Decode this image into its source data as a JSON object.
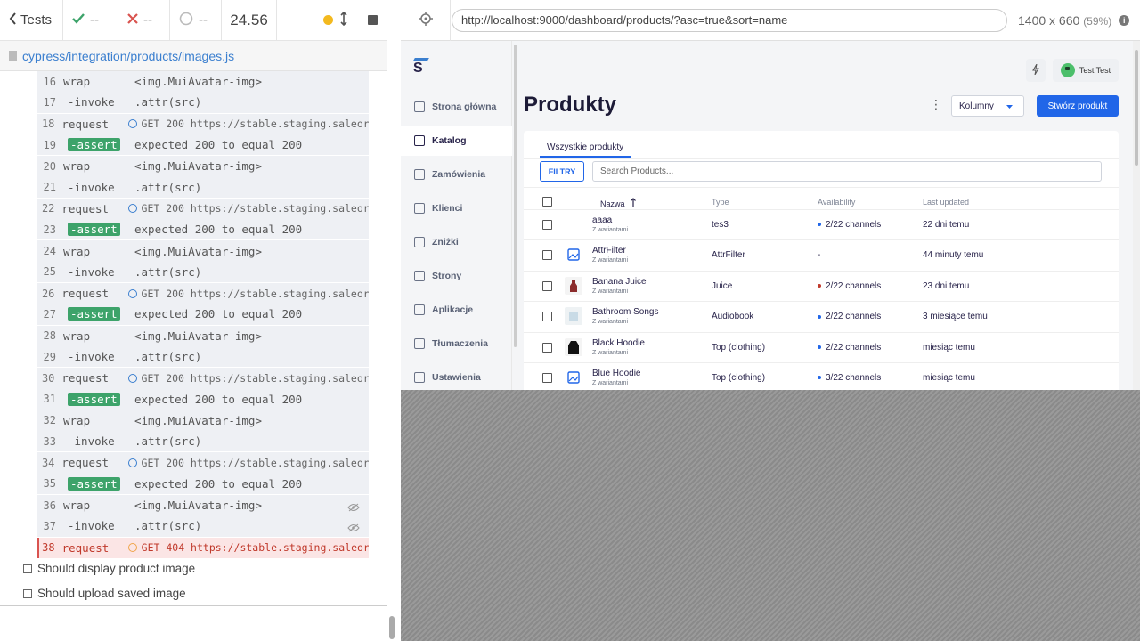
{
  "header": {
    "tests_label": "Tests",
    "passed": "--",
    "failed": "--",
    "pending": "--",
    "duration": "24.56"
  },
  "spec": {
    "path": "cypress/integration/products/images.js"
  },
  "commands": [
    {
      "num": "16",
      "name": "wrap",
      "msg": "<img.MuiAvatar-img>",
      "type": "plain"
    },
    {
      "num": "17",
      "name": "-invoke",
      "msg": ".attr(src)",
      "type": "child"
    },
    {
      "num": "18",
      "name": "request",
      "msg": "GET 200 https://stable.staging.saleor...",
      "type": "request"
    },
    {
      "num": "19",
      "name": "-assert",
      "msg": "expected 200 to equal 200",
      "type": "assert"
    },
    {
      "num": "20",
      "name": "wrap",
      "msg": "<img.MuiAvatar-img>",
      "type": "plain"
    },
    {
      "num": "21",
      "name": "-invoke",
      "msg": ".attr(src)",
      "type": "child"
    },
    {
      "num": "22",
      "name": "request",
      "msg": "GET 200 https://stable.staging.saleor...",
      "type": "request"
    },
    {
      "num": "23",
      "name": "-assert",
      "msg": "expected 200 to equal 200",
      "type": "assert"
    },
    {
      "num": "24",
      "name": "wrap",
      "msg": "<img.MuiAvatar-img>",
      "type": "plain"
    },
    {
      "num": "25",
      "name": "-invoke",
      "msg": ".attr(src)",
      "type": "child"
    },
    {
      "num": "26",
      "name": "request",
      "msg": "GET 200 https://stable.staging.saleor...",
      "type": "request"
    },
    {
      "num": "27",
      "name": "-assert",
      "msg": "expected 200 to equal 200",
      "type": "assert"
    },
    {
      "num": "28",
      "name": "wrap",
      "msg": "<img.MuiAvatar-img>",
      "type": "plain"
    },
    {
      "num": "29",
      "name": "-invoke",
      "msg": ".attr(src)",
      "type": "child"
    },
    {
      "num": "30",
      "name": "request",
      "msg": "GET 200 https://stable.staging.saleor...",
      "type": "request"
    },
    {
      "num": "31",
      "name": "-assert",
      "msg": "expected 200 to equal 200",
      "type": "assert"
    },
    {
      "num": "32",
      "name": "wrap",
      "msg": "<img.MuiAvatar-img>",
      "type": "plain"
    },
    {
      "num": "33",
      "name": "-invoke",
      "msg": ".attr(src)",
      "type": "child"
    },
    {
      "num": "34",
      "name": "request",
      "msg": "GET 200 https://stable.staging.saleor...",
      "type": "request"
    },
    {
      "num": "35",
      "name": "-assert",
      "msg": "expected 200 to equal 200",
      "type": "assert"
    },
    {
      "num": "36",
      "name": "wrap",
      "msg": "<img.MuiAvatar-img>",
      "type": "plain-eye"
    },
    {
      "num": "37",
      "name": "-invoke",
      "msg": ".attr(src)",
      "type": "child-eye"
    },
    {
      "num": "38",
      "name": "request",
      "msg": "GET 404 https://stable.staging.saleor...",
      "type": "failed"
    }
  ],
  "tests": [
    {
      "label": "Should display product image"
    },
    {
      "label": "Should upload saved image"
    }
  ],
  "browser": {
    "url": "http://localhost:9000/dashboard/products/?asc=true&sort=name",
    "viewport": "1400 x 660",
    "scale": "(59%)"
  },
  "app": {
    "logo": "S",
    "nav": [
      {
        "label": "Strona główna",
        "icon": "home-icon"
      },
      {
        "label": "Katalog",
        "icon": "catalog-icon",
        "active": true
      },
      {
        "label": "Zamówienia",
        "icon": "cart-icon"
      },
      {
        "label": "Klienci",
        "icon": "person-icon"
      },
      {
        "label": "Zniżki",
        "icon": "tag-icon"
      },
      {
        "label": "Strony",
        "icon": "pages-icon"
      },
      {
        "label": "Aplikacje",
        "icon": "apps-icon"
      },
      {
        "label": "Tłumaczenia",
        "icon": "globe-icon"
      },
      {
        "label": "Ustawienia",
        "icon": "settings-icon"
      }
    ],
    "user": "Test Test",
    "title": "Produkty",
    "columns_btn": "Kolumny",
    "create_btn": "Stwórz produkt",
    "tab": "Wszystkie produkty",
    "filter_btn": "FILTRY",
    "search_placeholder": "Search Products...",
    "headers": {
      "name": "Nazwa",
      "type": "Type",
      "availability": "Availability",
      "updated": "Last updated"
    },
    "rows": [
      {
        "name": "aaaa",
        "sub": "Z wariantami",
        "type": "tes3",
        "avail": "2/22 channels",
        "dot": "blue",
        "updated": "22 dni temu",
        "thumb": "green"
      },
      {
        "name": "AttrFilter",
        "sub": "Z wariantami",
        "type": "AttrFilter",
        "avail": "-",
        "dot": "none",
        "updated": "44 minuty temu",
        "thumb": "placeholder"
      },
      {
        "name": "Banana Juice",
        "sub": "Z wariantami",
        "type": "Juice",
        "avail": "2/22 channels",
        "dot": "red",
        "updated": "23 dni temu",
        "thumb": "bottle"
      },
      {
        "name": "Bathroom Songs",
        "sub": "Z wariantami",
        "type": "Audiobook",
        "avail": "2/22 channels",
        "dot": "blue",
        "updated": "3 miesiące temu",
        "thumb": "book"
      },
      {
        "name": "Black Hoodie",
        "sub": "Z wariantami",
        "type": "Top (clothing)",
        "avail": "2/22 channels",
        "dot": "blue",
        "updated": "miesiąc temu",
        "thumb": "hoodie"
      },
      {
        "name": "Blue Hoodie",
        "sub": "Z wariantami",
        "type": "Top (clothing)",
        "avail": "3/22 channels",
        "dot": "blue",
        "updated": "miesiąc temu",
        "thumb": "placeholder"
      }
    ]
  }
}
